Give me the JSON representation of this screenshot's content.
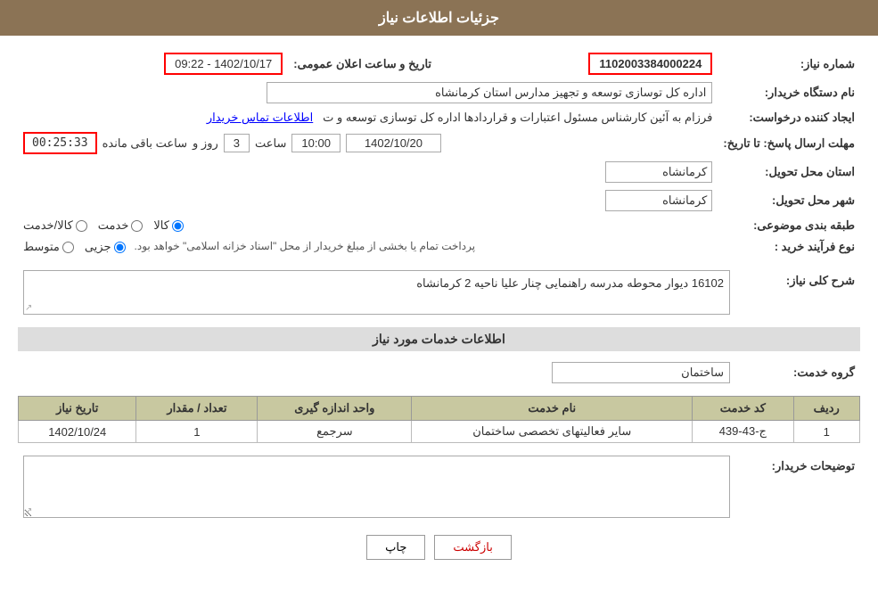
{
  "header": {
    "title": "جزئیات اطلاعات نیاز"
  },
  "fields": {
    "need_number_label": "شماره نیاز:",
    "need_number_value": "1102003384000224",
    "buyer_org_label": "نام دستگاه خریدار:",
    "buyer_org_value": "اداره کل توسازی  توسعه و تجهیز مدارس استان کرمانشاه",
    "creator_label": "ایجاد کننده درخواست:",
    "creator_value": "فرزام به آئین کارشناس مسئول اعتبارات و قراردادها اداره کل توسازی  توسعه و ت",
    "creator_link": "اطلاعات تماس خریدار",
    "deadline_label": "مهلت ارسال پاسخ: تا تاریخ:",
    "announcement_date_label": "تاریخ و ساعت اعلان عمومی:",
    "announcement_date_value": "1402/10/17 - 09:22",
    "date_value": "1402/10/20",
    "time_value": "10:00",
    "days_value": "3",
    "timer_value": "00:25:33",
    "remaining_label": "ساعت باقی مانده",
    "province_label": "استان محل تحویل:",
    "province_value": "کرمانشاه",
    "city_label": "شهر محل تحویل:",
    "city_value": "کرمانشاه",
    "category_label": "طبقه بندی موضوعی:",
    "product_option": "کالا",
    "service_option": "خدمت",
    "goods_service_option": "کالا/خدمت",
    "purchase_type_label": "نوع فرآیند خرید :",
    "partial_option": "جزیی",
    "medium_option": "متوسط",
    "payment_note": "پرداخت تمام یا بخشی از مبلغ خریدار از محل \"اسناد خزانه اسلامی\" خواهد بود.",
    "need_desc_label": "شرح کلی نیاز:",
    "need_desc_value": "16102 دیوار محوطه مدرسه راهنمایی چنار علیا ناحیه 2 کرمانشاه",
    "services_title": "اطلاعات خدمات مورد نیاز",
    "service_group_label": "گروه خدمت:",
    "service_group_value": "ساختمان",
    "table": {
      "col_row": "ردیف",
      "col_code": "کد خدمت",
      "col_name": "نام خدمت",
      "col_unit": "واحد اندازه گیری",
      "col_qty": "تعداد / مقدار",
      "col_date": "تاریخ نیاز",
      "rows": [
        {
          "row": "1",
          "code": "ج-43-439",
          "name": "سایر فعالیتهای تخصصی ساختمان",
          "unit": "سرجمع",
          "qty": "1",
          "date": "1402/10/24"
        }
      ]
    },
    "buyer_notes_label": "توضیحات خریدار:",
    "btn_print": "چاپ",
    "btn_back": "بازگشت"
  }
}
